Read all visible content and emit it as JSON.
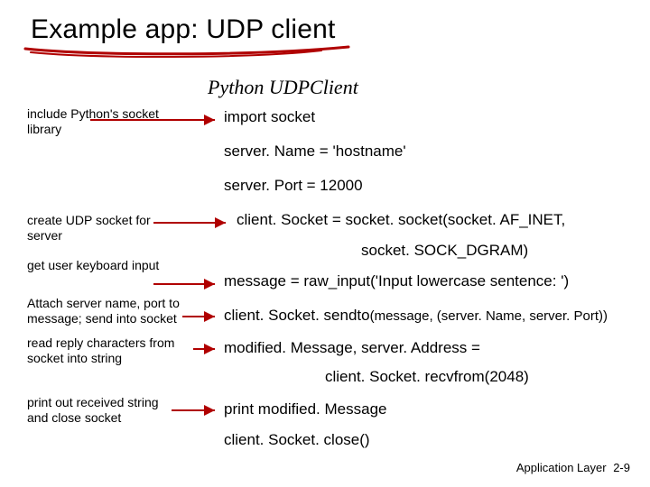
{
  "title": "Example app: UDP client",
  "subtitle": "Python UDPClient",
  "annotations": {
    "a1": "include Python's socket library",
    "a2": "create UDP socket for server",
    "a3": "get user keyboard input",
    "a4": "Attach server name, port to message; send into socket",
    "a5": "read reply characters from socket into string",
    "a6": "print out received string and close socket"
  },
  "code": {
    "l1": "import socket",
    "l2": "server. Name = 'hostname'",
    "l3": "server. Port = 12000",
    "l4": "client. Socket = socket. socket(socket. AF_INET,",
    "l4b": "socket. SOCK_DGRAM)",
    "l5": "message = raw_input('Input lowercase sentence: ')",
    "l6a": "client. Socket. sendto",
    "l6b": "(message, (server. Name, server. Port))",
    "l7": "modified. Message, server. Address =",
    "l7b": "client. Socket. recvfrom(2048)",
    "l8": "print modified. Message",
    "l9": "client. Socket. close()"
  },
  "footer": {
    "label": "Application Layer",
    "page": "2-9"
  }
}
